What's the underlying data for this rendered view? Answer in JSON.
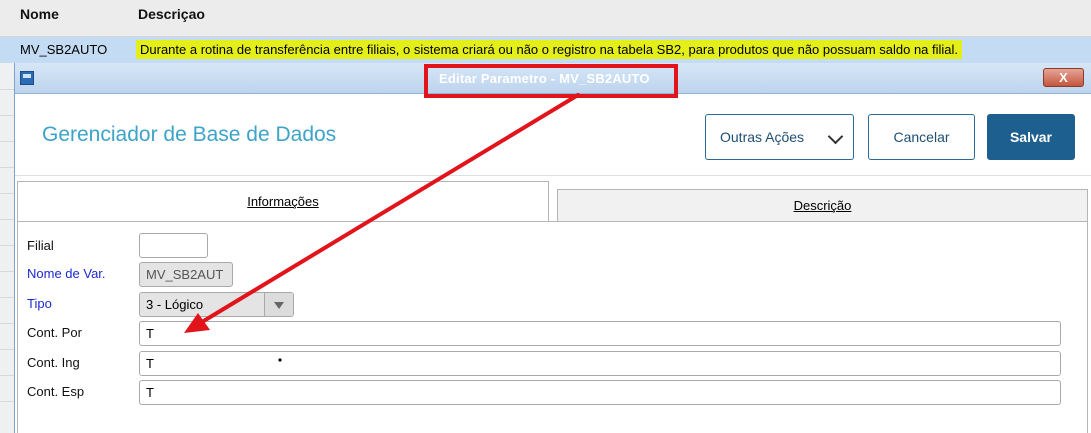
{
  "list": {
    "columns": {
      "name": "Nome",
      "description": "Descriçao"
    },
    "row": {
      "name": "MV_SB2AUTO",
      "description": "Durante a rotina de transferência entre filiais, o sistema criará ou não o registro na tabela SB2, para produtos que não possuam saldo na filial."
    }
  },
  "dialog": {
    "title": "Editar Parametro - MV_SB2AUTO",
    "close_label": "X",
    "heading": "Gerenciador de Base de Dados",
    "actions": {
      "more_label": "Outras Ações",
      "cancel_label": "Cancelar",
      "save_label": "Salvar"
    },
    "tabs": [
      {
        "label": "Informações",
        "active": true
      },
      {
        "label": "Descrição",
        "active": false
      }
    ],
    "fields": {
      "filial": {
        "label": "Filial",
        "value": ""
      },
      "nome_var": {
        "label": "Nome de Var.",
        "value": "MV_SB2AUT"
      },
      "tipo": {
        "label": "Tipo",
        "value": "3 - Lógico"
      },
      "cont_por": {
        "label": "Cont. Por",
        "value": "T"
      },
      "cont_ing": {
        "label": "Cont. Ing",
        "value": "T"
      },
      "cont_esp": {
        "label": "Cont. Esp",
        "value": "T"
      }
    }
  },
  "colors": {
    "accent": "#3da3c8",
    "primary_button": "#1d5f8e",
    "highlight": "#e4ef1a",
    "annotation": "#e0141a",
    "selected_row": "#c3dcf3"
  },
  "icons": {
    "window": "app-window-icon",
    "dropdown": "chevron-down-icon",
    "select": "select-arrow-icon"
  }
}
